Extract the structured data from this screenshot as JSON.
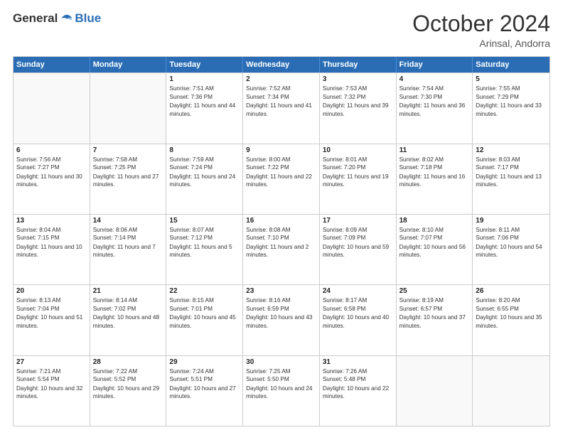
{
  "header": {
    "logo_general": "General",
    "logo_blue": "Blue",
    "month_title": "October 2024",
    "location": "Arinsal, Andorra"
  },
  "days_of_week": [
    "Sunday",
    "Monday",
    "Tuesday",
    "Wednesday",
    "Thursday",
    "Friday",
    "Saturday"
  ],
  "weeks": [
    [
      {
        "day": "",
        "sunrise": "",
        "sunset": "",
        "daylight": ""
      },
      {
        "day": "",
        "sunrise": "",
        "sunset": "",
        "daylight": ""
      },
      {
        "day": "1",
        "sunrise": "Sunrise: 7:51 AM",
        "sunset": "Sunset: 7:36 PM",
        "daylight": "Daylight: 11 hours and 44 minutes."
      },
      {
        "day": "2",
        "sunrise": "Sunrise: 7:52 AM",
        "sunset": "Sunset: 7:34 PM",
        "daylight": "Daylight: 11 hours and 41 minutes."
      },
      {
        "day": "3",
        "sunrise": "Sunrise: 7:53 AM",
        "sunset": "Sunset: 7:32 PM",
        "daylight": "Daylight: 11 hours and 39 minutes."
      },
      {
        "day": "4",
        "sunrise": "Sunrise: 7:54 AM",
        "sunset": "Sunset: 7:30 PM",
        "daylight": "Daylight: 11 hours and 36 minutes."
      },
      {
        "day": "5",
        "sunrise": "Sunrise: 7:55 AM",
        "sunset": "Sunset: 7:29 PM",
        "daylight": "Daylight: 11 hours and 33 minutes."
      }
    ],
    [
      {
        "day": "6",
        "sunrise": "Sunrise: 7:56 AM",
        "sunset": "Sunset: 7:27 PM",
        "daylight": "Daylight: 11 hours and 30 minutes."
      },
      {
        "day": "7",
        "sunrise": "Sunrise: 7:58 AM",
        "sunset": "Sunset: 7:25 PM",
        "daylight": "Daylight: 11 hours and 27 minutes."
      },
      {
        "day": "8",
        "sunrise": "Sunrise: 7:59 AM",
        "sunset": "Sunset: 7:24 PM",
        "daylight": "Daylight: 11 hours and 24 minutes."
      },
      {
        "day": "9",
        "sunrise": "Sunrise: 8:00 AM",
        "sunset": "Sunset: 7:22 PM",
        "daylight": "Daylight: 11 hours and 22 minutes."
      },
      {
        "day": "10",
        "sunrise": "Sunrise: 8:01 AM",
        "sunset": "Sunset: 7:20 PM",
        "daylight": "Daylight: 11 hours and 19 minutes."
      },
      {
        "day": "11",
        "sunrise": "Sunrise: 8:02 AM",
        "sunset": "Sunset: 7:18 PM",
        "daylight": "Daylight: 11 hours and 16 minutes."
      },
      {
        "day": "12",
        "sunrise": "Sunrise: 8:03 AM",
        "sunset": "Sunset: 7:17 PM",
        "daylight": "Daylight: 11 hours and 13 minutes."
      }
    ],
    [
      {
        "day": "13",
        "sunrise": "Sunrise: 8:04 AM",
        "sunset": "Sunset: 7:15 PM",
        "daylight": "Daylight: 11 hours and 10 minutes."
      },
      {
        "day": "14",
        "sunrise": "Sunrise: 8:06 AM",
        "sunset": "Sunset: 7:14 PM",
        "daylight": "Daylight: 11 hours and 7 minutes."
      },
      {
        "day": "15",
        "sunrise": "Sunrise: 8:07 AM",
        "sunset": "Sunset: 7:12 PM",
        "daylight": "Daylight: 11 hours and 5 minutes."
      },
      {
        "day": "16",
        "sunrise": "Sunrise: 8:08 AM",
        "sunset": "Sunset: 7:10 PM",
        "daylight": "Daylight: 11 hours and 2 minutes."
      },
      {
        "day": "17",
        "sunrise": "Sunrise: 8:09 AM",
        "sunset": "Sunset: 7:09 PM",
        "daylight": "Daylight: 10 hours and 59 minutes."
      },
      {
        "day": "18",
        "sunrise": "Sunrise: 8:10 AM",
        "sunset": "Sunset: 7:07 PM",
        "daylight": "Daylight: 10 hours and 56 minutes."
      },
      {
        "day": "19",
        "sunrise": "Sunrise: 8:11 AM",
        "sunset": "Sunset: 7:06 PM",
        "daylight": "Daylight: 10 hours and 54 minutes."
      }
    ],
    [
      {
        "day": "20",
        "sunrise": "Sunrise: 8:13 AM",
        "sunset": "Sunset: 7:04 PM",
        "daylight": "Daylight: 10 hours and 51 minutes."
      },
      {
        "day": "21",
        "sunrise": "Sunrise: 8:14 AM",
        "sunset": "Sunset: 7:02 PM",
        "daylight": "Daylight: 10 hours and 48 minutes."
      },
      {
        "day": "22",
        "sunrise": "Sunrise: 8:15 AM",
        "sunset": "Sunset: 7:01 PM",
        "daylight": "Daylight: 10 hours and 45 minutes."
      },
      {
        "day": "23",
        "sunrise": "Sunrise: 8:16 AM",
        "sunset": "Sunset: 6:59 PM",
        "daylight": "Daylight: 10 hours and 43 minutes."
      },
      {
        "day": "24",
        "sunrise": "Sunrise: 8:17 AM",
        "sunset": "Sunset: 6:58 PM",
        "daylight": "Daylight: 10 hours and 40 minutes."
      },
      {
        "day": "25",
        "sunrise": "Sunrise: 8:19 AM",
        "sunset": "Sunset: 6:57 PM",
        "daylight": "Daylight: 10 hours and 37 minutes."
      },
      {
        "day": "26",
        "sunrise": "Sunrise: 8:20 AM",
        "sunset": "Sunset: 6:55 PM",
        "daylight": "Daylight: 10 hours and 35 minutes."
      }
    ],
    [
      {
        "day": "27",
        "sunrise": "Sunrise: 7:21 AM",
        "sunset": "Sunset: 5:54 PM",
        "daylight": "Daylight: 10 hours and 32 minutes."
      },
      {
        "day": "28",
        "sunrise": "Sunrise: 7:22 AM",
        "sunset": "Sunset: 5:52 PM",
        "daylight": "Daylight: 10 hours and 29 minutes."
      },
      {
        "day": "29",
        "sunrise": "Sunrise: 7:24 AM",
        "sunset": "Sunset: 5:51 PM",
        "daylight": "Daylight: 10 hours and 27 minutes."
      },
      {
        "day": "30",
        "sunrise": "Sunrise: 7:25 AM",
        "sunset": "Sunset: 5:50 PM",
        "daylight": "Daylight: 10 hours and 24 minutes."
      },
      {
        "day": "31",
        "sunrise": "Sunrise: 7:26 AM",
        "sunset": "Sunset: 5:48 PM",
        "daylight": "Daylight: 10 hours and 22 minutes."
      },
      {
        "day": "",
        "sunrise": "",
        "sunset": "",
        "daylight": ""
      },
      {
        "day": "",
        "sunrise": "",
        "sunset": "",
        "daylight": ""
      }
    ]
  ]
}
